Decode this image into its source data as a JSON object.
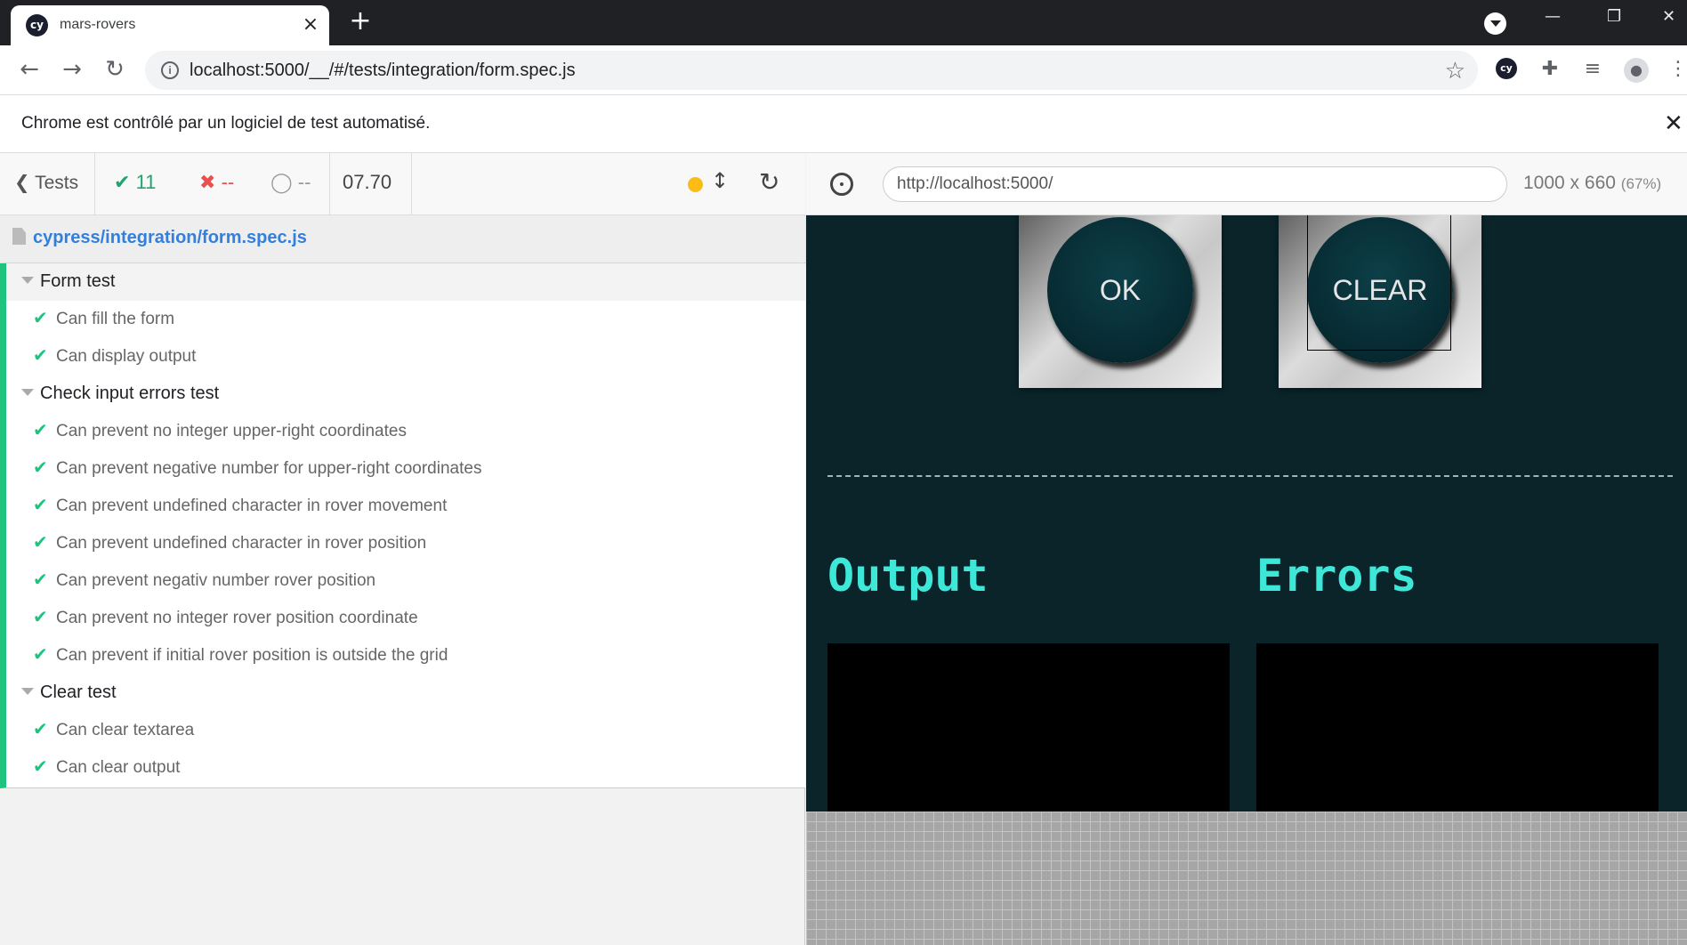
{
  "browser": {
    "tab_title": "mars-rovers",
    "favicon_text": "cy",
    "url": "localhost:5000/__/#/tests/integration/form.spec.js",
    "infobar_text": "Chrome est contrôlé par un logiciel de test automatisé."
  },
  "reporter": {
    "tests_label": "Tests",
    "passed_count": "11",
    "failed_count": "--",
    "pending_count": "--",
    "duration": "07.70",
    "spec_path": "cypress/integration/form.spec.js",
    "suites": [
      {
        "title": "Form test",
        "tests": [
          "Can fill the form",
          "Can display output"
        ]
      },
      {
        "title": "Check input errors test",
        "tests": [
          "Can prevent no integer upper-right coordinates",
          "Can prevent negative number for upper-right coordinates",
          "Can prevent undefined character in rover movement",
          "Can prevent undefined character in rover position",
          "Can prevent negativ number rover position",
          "Can prevent no integer rover position coordinate",
          "Can prevent if initial rover position is outside the grid"
        ]
      },
      {
        "title": "Clear test",
        "tests": [
          "Can clear textarea",
          "Can clear output"
        ]
      }
    ]
  },
  "aut": {
    "url": "http://localhost:5000/",
    "viewport": "1000 x 660",
    "zoom": "(67%)",
    "ok_label": "OK",
    "clear_label": "CLEAR",
    "output_heading": "Output",
    "errors_heading": "Errors"
  },
  "colors": {
    "passed": "#1ec47e",
    "failed": "#e94f4f",
    "link": "#3380dc",
    "app_background": "#0a242a",
    "heading": "#3ee8d9"
  }
}
